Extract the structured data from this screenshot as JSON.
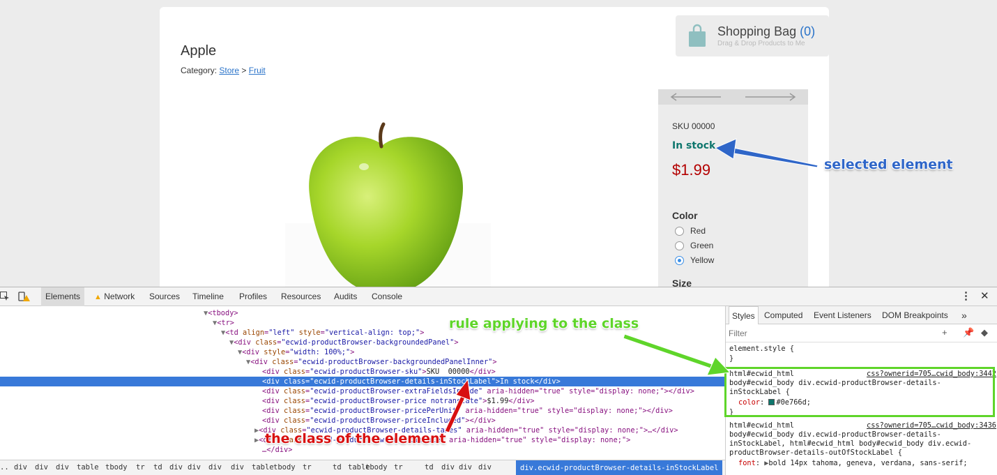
{
  "store": {
    "product_title": "Apple",
    "category_label": "Category:",
    "category_store": "Store",
    "category_sep": ">",
    "category_fruit": "Fruit",
    "bag_title": "Shopping Bag",
    "bag_count": "(0)",
    "bag_sub": "Drag & Drop Products to Me",
    "sku": "SKU 00000",
    "in_stock": "In stock",
    "price": "$1.99",
    "color_label": "Color",
    "colors": [
      "Red",
      "Green",
      "Yellow"
    ],
    "selected_color": "Yellow",
    "size_label": "Size"
  },
  "annotations": {
    "selected": "selected element",
    "rule": "rule applying to the class",
    "class": "the class of the element"
  },
  "devtools": {
    "tabs": [
      "Elements",
      "Network",
      "Sources",
      "Timeline",
      "Profiles",
      "Resources",
      "Audits",
      "Console"
    ],
    "active_tab": "Elements",
    "styles_tabs": [
      "Styles",
      "Computed",
      "Event Listeners",
      "DOM Breakpoints"
    ],
    "more": "»",
    "filter_placeholder": "Filter",
    "element_style": "element.style {",
    "close_brace": "}",
    "rule1_selector_1": "html#ecwid_html",
    "rule1_src": "css?ownerid=705…cwid_body:3442",
    "rule1_selector_2": "body#ecwid_body div.ecwid-productBrowser-details-",
    "rule1_selector_3": "inStockLabel {",
    "rule1_prop": "color",
    "rule1_value": "#0e766d;",
    "rule2_selector_1": "html#ecwid_html",
    "rule2_src": "css?ownerid=705…cwid_body:3436",
    "rule2_selector_2": "body#ecwid_body div.ecwid-productBrowser-details-",
    "rule2_selector_3": "inStockLabel, html#ecwid_html body#ecwid_body div.ecwid-",
    "rule2_selector_4": "productBrowser-details-outOfStockLabel {",
    "rule2_prop": "font",
    "rule2_value": "bold 14px tahoma, geneva, verdana, sans-serif;",
    "breadcrumbs": [
      "div",
      "div",
      "div",
      "table",
      "tbody",
      "tr",
      "td",
      "div",
      "div",
      "div",
      "div",
      "table",
      "tbody",
      "tr",
      "td",
      "table",
      "tbody",
      "tr",
      "td",
      "div",
      "div",
      "div"
    ],
    "breadcrumb_selected": "div.ecwid-productBrowser-details-inStockLabel",
    "dom": {
      "l1": "<tbody>",
      "l2": "<tr>",
      "l3_tag": "<td ",
      "l3_a1": "align",
      "l3_v1": "\"left\"",
      "l3_a2": "style",
      "l3_v2": "\"vertical-align: top;\"",
      "l4_v": "\"ecwid-productBrowser-backgroundedPanel\"",
      "l5_v": "\"width: 100%;\"",
      "l6_v": "\"ecwid-productBrowser-backgroundedPanelInner\"",
      "l7_v": "\"ecwid-productBrowser-sku\"",
      "l7_t": "SKU  00000",
      "l8_v": "\"ecwid-productBrowser-details-inStockLabel\"",
      "l8_t": "In stock",
      "l9_v": "\"ecwid-productBrowser-extraFieldsInside\"",
      "l9_r": " aria-hidden=\"true\" style=\"display: none;\"></div>",
      "l10_v": "\"ecwid-productBrowser-price notranslate\"",
      "l10_t": "$1.99",
      "l11_v": "\"ecwid-productBrowser-pricePerUnit\"",
      "l11_r": " aria-hidden=\"true\" style=\"display: none;\"></div>",
      "l12_v": "\"ecwid-productBrowser-priceIncluded\"",
      "l13_v": "\"ecwid-productBrowser-details-taxes\"",
      "l13_r": " aria-hidden=\"true\" style=\"display: none;\">…</div>",
      "l14_v": "\"ecwid-productBrowser-wholesale\"",
      "l14_r": " aria-hidden=\"true\" style=\"display: none;\">",
      "l15": "…</div>"
    }
  }
}
